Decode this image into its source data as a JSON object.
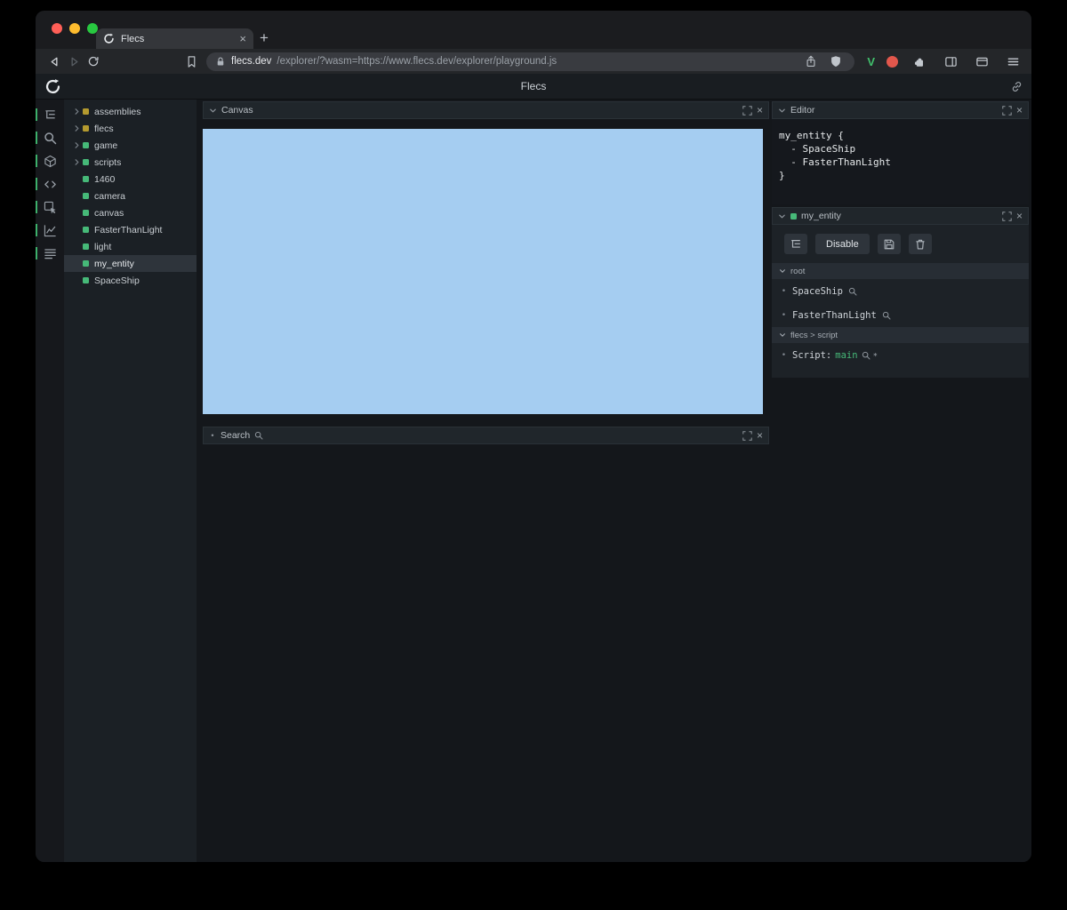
{
  "colors": {
    "accent_green": "#3db06b",
    "entity_green": "#46b978",
    "entity_yellow": "#b49a2f",
    "canvas_blue": "#a5cdf1"
  },
  "icons": {
    "close": "×",
    "new_tab": "+",
    "bullet": "•",
    "dot": "•",
    "asterisk": "∗",
    "ext_v": "V"
  },
  "browser": {
    "tab_title": "Flecs",
    "url_host": "flecs.dev",
    "url_rest": "/explorer/?wasm=https://www.flecs.dev/explorer/playground.js"
  },
  "app": {
    "title": "Flecs"
  },
  "tree": {
    "items": [
      {
        "label": "assemblies"
      },
      {
        "label": "flecs"
      },
      {
        "label": "game"
      },
      {
        "label": "scripts"
      },
      {
        "label": "1460"
      },
      {
        "label": "camera"
      },
      {
        "label": "canvas"
      },
      {
        "label": "FasterThanLight"
      },
      {
        "label": "light"
      },
      {
        "label": "my_entity"
      },
      {
        "label": "SpaceShip"
      }
    ]
  },
  "panels": {
    "canvas": {
      "title": "Canvas"
    },
    "search": {
      "title": "Search"
    },
    "editor": {
      "title": "Editor",
      "code": [
        "my_entity {",
        "  - SpaceShip",
        "  - FasterThanLight",
        "}"
      ]
    },
    "entity": {
      "title": "my_entity",
      "disable_button": "Disable",
      "root_section": {
        "title": "root",
        "items": [
          {
            "label": "SpaceShip"
          },
          {
            "label": "FasterThanLight"
          }
        ]
      },
      "script_section": {
        "title": "flecs > script",
        "item_label": "Script:",
        "item_value": "main"
      }
    }
  }
}
